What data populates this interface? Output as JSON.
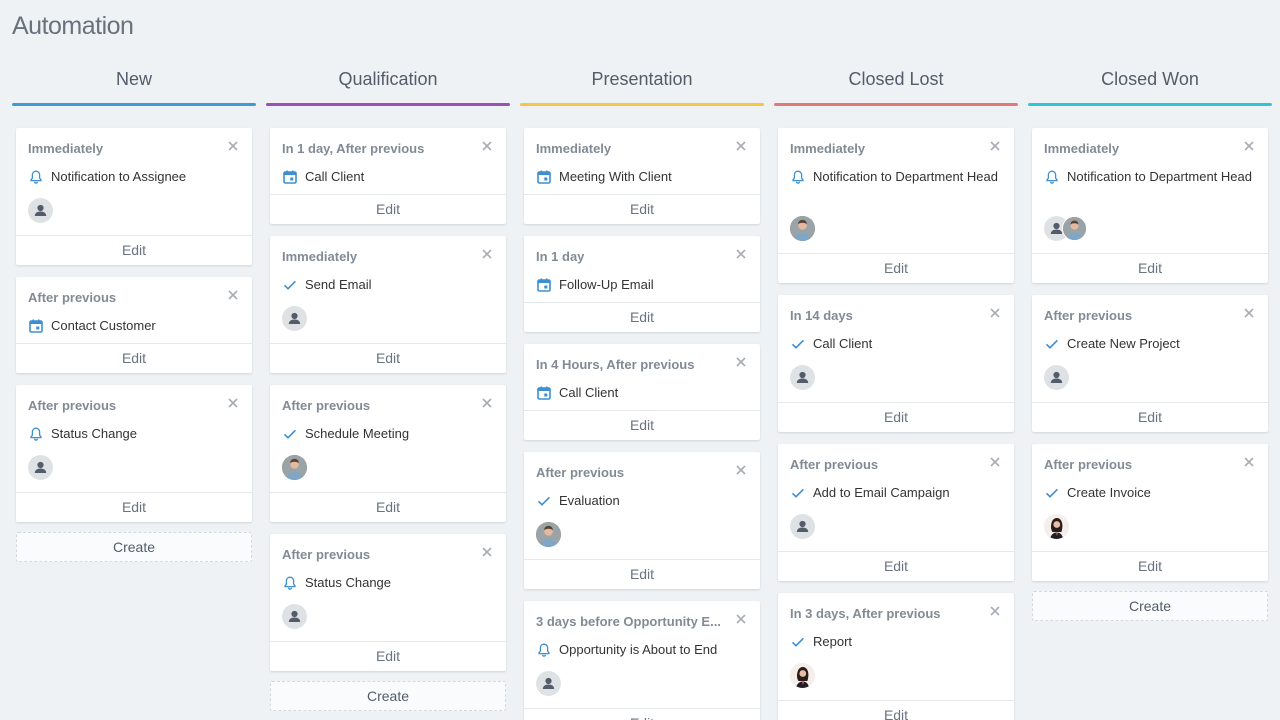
{
  "page_title": "Automation",
  "columns": [
    {
      "title": "New",
      "color": "#3d9bd8",
      "create_label": "Create",
      "cards": [
        {
          "when": "Immediately",
          "icon": "bell-icon",
          "action": "Notification to Assignee",
          "avatars": [
            "placeholder"
          ],
          "edit": "Edit"
        },
        {
          "when": "After previous",
          "icon": "calendar-icon",
          "action": "Contact Customer",
          "avatars": [],
          "edit": "Edit"
        },
        {
          "when": "After previous",
          "icon": "bell-icon",
          "action": "Status Change",
          "avatars": [
            "placeholder"
          ],
          "edit": "Edit"
        }
      ]
    },
    {
      "title": "Qualification",
      "color": "#9b4fb7",
      "create_label": "Create",
      "cards": [
        {
          "when": "In 1 day, After previous",
          "icon": "calendar-icon",
          "action": "Call Client",
          "avatars": [],
          "edit": "Edit"
        },
        {
          "when": "Immediately",
          "icon": "check-icon",
          "action": "Send Email",
          "avatars": [
            "placeholder"
          ],
          "edit": "Edit"
        },
        {
          "when": "After previous",
          "icon": "check-icon",
          "action": "Schedule Meeting",
          "avatars": [
            "male-photo"
          ],
          "edit": "Edit"
        },
        {
          "when": "After previous",
          "icon": "bell-icon",
          "action": "Status Change",
          "avatars": [
            "placeholder"
          ],
          "edit": "Edit"
        }
      ]
    },
    {
      "title": "Presentation",
      "color": "#f2c745",
      "create_label": "",
      "cards": [
        {
          "when": "Immediately",
          "icon": "calendar-icon",
          "action": "Meeting With Client",
          "avatars": [],
          "edit": "Edit"
        },
        {
          "when": "In 1 day",
          "icon": "calendar-icon",
          "action": "Follow-Up Email",
          "avatars": [],
          "edit": "Edit"
        },
        {
          "when": "In 4 Hours, After previous",
          "icon": "calendar-icon",
          "action": "Call Client",
          "avatars": [],
          "edit": "Edit"
        },
        {
          "when": "After previous",
          "icon": "check-icon",
          "action": "Evaluation",
          "avatars": [
            "male-photo"
          ],
          "edit": "Edit"
        },
        {
          "when": "3 days before Opportunity E...",
          "icon": "bell-icon",
          "action": "Opportunity is About to End",
          "avatars": [
            "placeholder"
          ],
          "edit": "Edit"
        }
      ]
    },
    {
      "title": "Closed Lost",
      "color": "#e07b7b",
      "create_label": "",
      "cards": [
        {
          "when": "Immediately",
          "icon": "bell-icon",
          "action": "Notification to Department Head",
          "avatars": [
            "male-photo"
          ],
          "edit": "Edit"
        },
        {
          "when": "In 14 days",
          "icon": "check-icon",
          "action": "Call Client",
          "avatars": [
            "placeholder"
          ],
          "edit": "Edit"
        },
        {
          "when": "After previous",
          "icon": "check-icon",
          "action": "Add to Email Campaign",
          "avatars": [
            "placeholder"
          ],
          "edit": "Edit"
        },
        {
          "when": "In 3 days, After previous",
          "icon": "check-icon",
          "action": "Report",
          "avatars": [
            "female-photo"
          ],
          "edit": "Edit"
        }
      ]
    },
    {
      "title": "Closed Won",
      "color": "#2fc4d8",
      "create_label": "Create",
      "cards": [
        {
          "when": "Immediately",
          "icon": "bell-icon",
          "action": "Notification to Department Head",
          "avatars": [
            "placeholder",
            "male-photo"
          ],
          "edit": "Edit"
        },
        {
          "when": "After previous",
          "icon": "check-icon",
          "action": "Create New Project",
          "avatars": [
            "placeholder"
          ],
          "edit": "Edit"
        },
        {
          "when": "After previous",
          "icon": "check-icon",
          "action": "Create Invoice",
          "avatars": [
            "female-photo"
          ],
          "edit": "Edit"
        }
      ]
    }
  ]
}
